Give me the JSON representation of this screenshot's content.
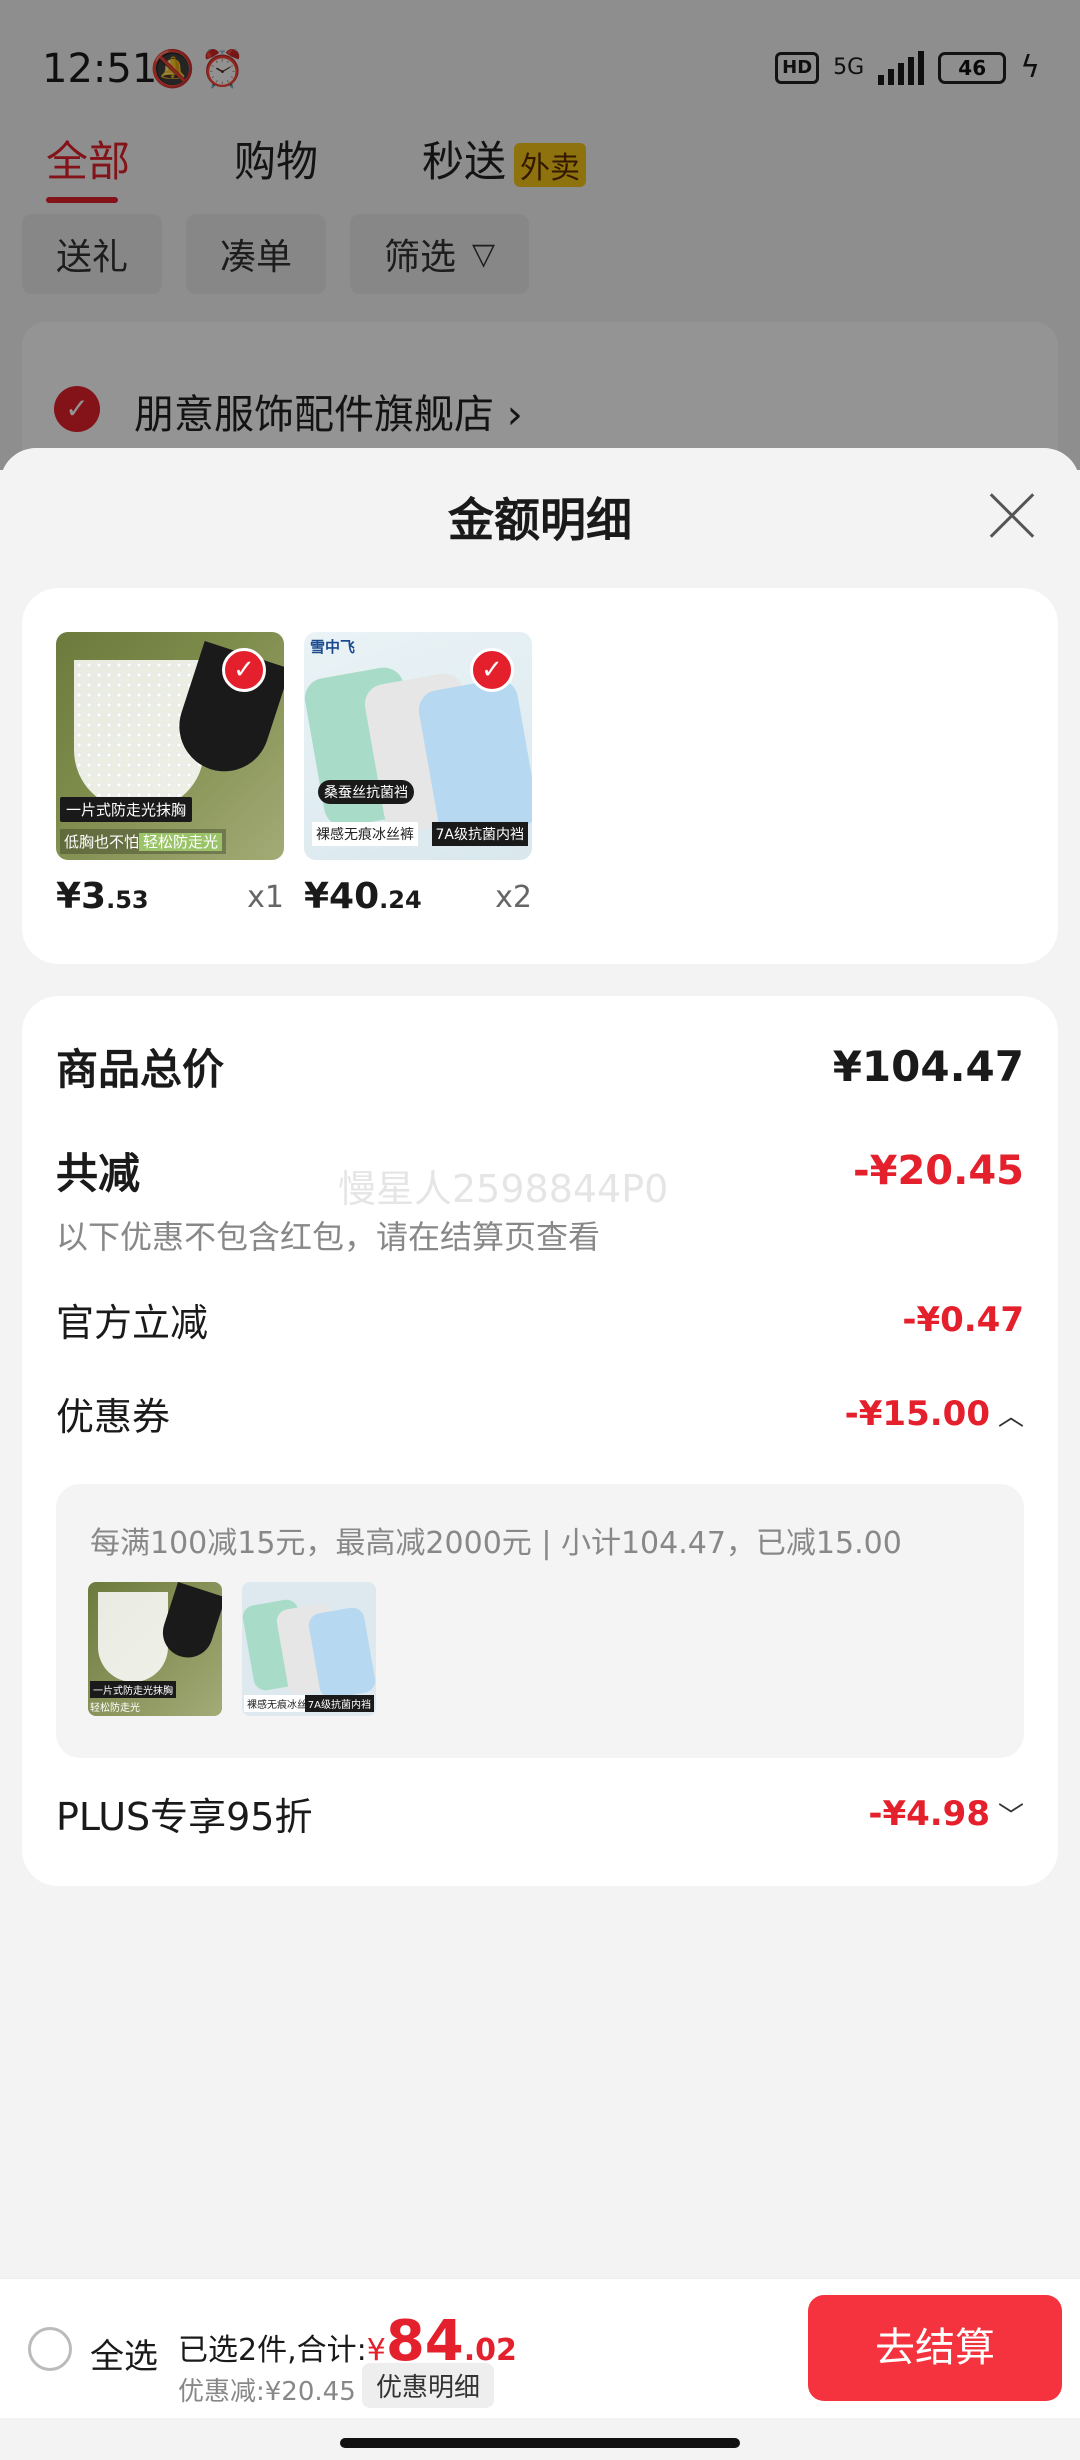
{
  "status_bar": {
    "time": "12:51",
    "hd": "HD",
    "network": "5G",
    "battery": "46"
  },
  "tabs": [
    {
      "label": "全部",
      "active": true
    },
    {
      "label": "购物",
      "active": false
    },
    {
      "label": "秒送",
      "badge": "外卖",
      "active": false
    }
  ],
  "chips": [
    "送礼",
    "凑单",
    "筛选"
  ],
  "shop": {
    "name": "朋意服饰配件旗舰店 ›"
  },
  "sheet": {
    "title": "金额明细",
    "items": [
      {
        "price_int": "¥3",
        "price_dec": ".53",
        "qty": "x1",
        "caption1": "一片式防走光抹胸",
        "caption2a": "低胸也不怕",
        "caption2b": "轻松防走光"
      },
      {
        "price_int": "¥40",
        "price_dec": ".24",
        "qty": "x2",
        "brand": "雪中飞",
        "caption1": "桑蚕丝抗菌裆",
        "caption2": "裸感无痕冰丝裤",
        "caption3": "7A级抗菌内裆"
      }
    ],
    "total_label": "商品总价",
    "total_value": "¥104.47",
    "reduce_label": "共减",
    "reduce_value": "-¥20.45",
    "reduce_note": "以下优惠不包含红包，请在结算页查看",
    "watermark": "慢星人2598844P0",
    "official_label": "官方立减",
    "official_value": "-¥0.47",
    "coupon_label": "优惠券",
    "coupon_value": "-¥15.00",
    "coupon_desc": "每满100减15元，最高减2000元 | 小计104.47，已减15.00",
    "plus_label": "PLUS专享95折",
    "plus_value": "-¥4.98"
  },
  "bottom": {
    "select_all": "全选",
    "selected_text": "已选2件,合计:",
    "currency": "¥",
    "total_int": "84",
    "total_dec": ".02",
    "saved_text": "优惠减:¥20.45",
    "detail_button": "优惠明细",
    "checkout_button": "去结算"
  },
  "colors": {
    "accent": "#e4202c",
    "checkout": "#f4333e"
  }
}
